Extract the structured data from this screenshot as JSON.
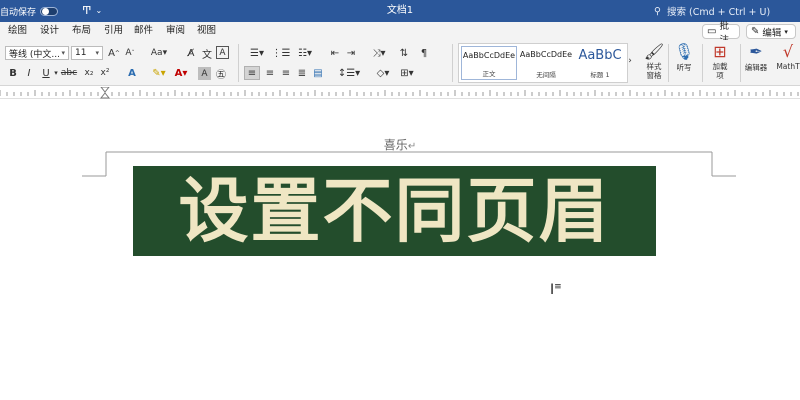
{
  "titlebar": {
    "autosave_label": "自动保存",
    "doc_title": "文档1",
    "search_placeholder": "搜索 (Cmd + Ctrl + U)"
  },
  "tabs": [
    "绘图",
    "设计",
    "布局",
    "引用",
    "邮件",
    "审阅",
    "视图"
  ],
  "pills": {
    "comment": "批注",
    "edit": "编辑"
  },
  "ribbon": {
    "font_name": "等线 (中文...",
    "font_size": "11",
    "styles": [
      {
        "sample": "AaBbCcDdEe",
        "name": "正文"
      },
      {
        "sample": "AaBbCcDdEe",
        "name": "无间隔"
      },
      {
        "sample": "AaBbC",
        "name": "标题 1"
      }
    ],
    "style_pane": "样式\n窗格",
    "dictate": "听写",
    "addins": "加载\n项",
    "editor": "编辑器",
    "mathtype": "MathT"
  },
  "document": {
    "header_text": "喜乐",
    "paragraph_mark": "↵",
    "banner_text": "设置不同页眉"
  }
}
